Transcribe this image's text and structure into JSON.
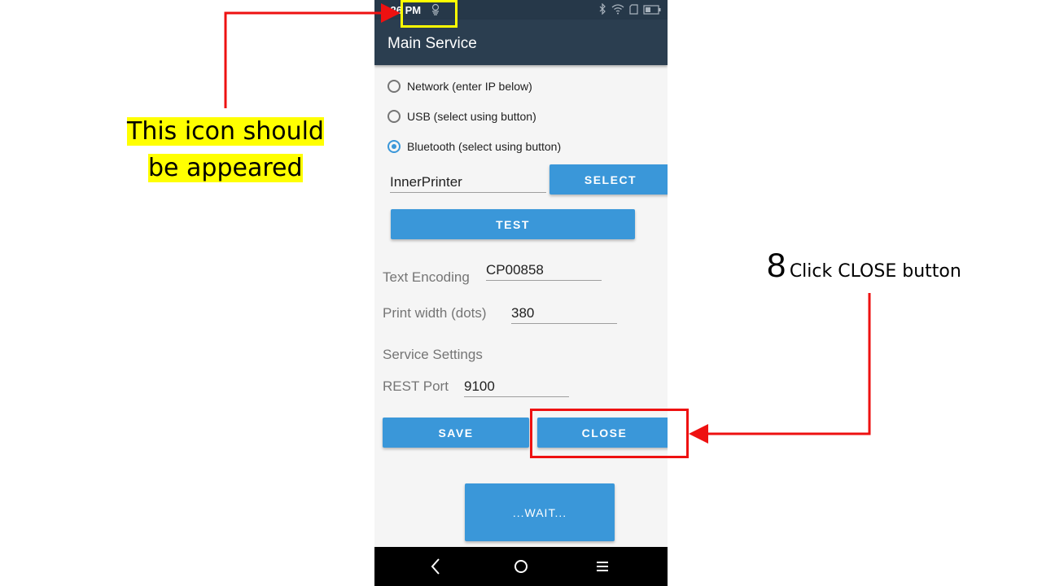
{
  "status_bar": {
    "time": "5:26 PM"
  },
  "app_bar": {
    "title": "Main Service"
  },
  "connection_options": [
    {
      "label": "Network (enter IP below)",
      "selected": false
    },
    {
      "label": "USB (select using button)",
      "selected": false
    },
    {
      "label": "Bluetooth (select using button)",
      "selected": true
    }
  ],
  "printer": {
    "name_value": "InnerPrinter",
    "select_label": "SELECT",
    "test_label": "TEST"
  },
  "settings": {
    "encoding_label": "Text Encoding",
    "encoding_value": "CP00858",
    "width_label": "Print width (dots)",
    "width_value": "380",
    "service_heading": "Service Settings",
    "port_label": "REST Port",
    "port_value": "9100"
  },
  "actions": {
    "save_label": "SAVE",
    "close_label": "CLOSE",
    "wait_label": "...WAIT..."
  },
  "annotations": {
    "icon_note_line1": "This icon should",
    "icon_note_line2": "be appeared",
    "step_number": "8",
    "step_text": "Click CLOSE button"
  },
  "colors": {
    "accent": "#3a97d9",
    "appbar": "#2b3e50",
    "annotation_red": "#ee1111",
    "highlight": "#ffff00"
  }
}
